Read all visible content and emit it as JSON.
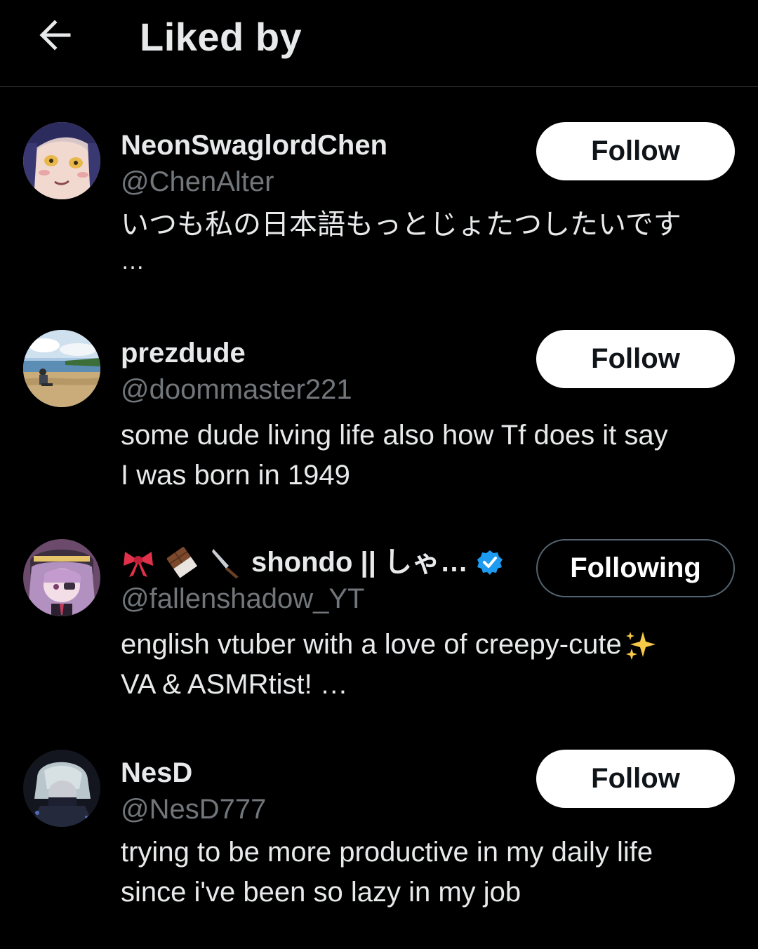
{
  "header": {
    "back_icon": "arrow-left-icon",
    "title": "Liked by"
  },
  "users": [
    {
      "display_name": "NeonSwaglordChen",
      "handle": "@ChenAlter",
      "bio_line1": "いつも私の日本語もっとじょたつしたいです",
      "bio_line2": "…",
      "button": "Follow"
    },
    {
      "display_name": "prezdude",
      "handle": "@doommaster221",
      "bio_line1": "some dude living life also how Tf does it say",
      "bio_line2": "I was born in 1949",
      "button": "Follow"
    },
    {
      "display_name": "shondo || しゃ…",
      "name_emojis": [
        "ribbon-icon",
        "chocolate-icon",
        "knife-icon"
      ],
      "verified": true,
      "handle": "@fallenshadow_YT",
      "bio_line1": "english vtuber with a love of creepy-cute",
      "bio_line1_emoji": "sparkles-icon",
      "bio_line2": "VA & ASMRtist! …",
      "button": "Following"
    },
    {
      "display_name": "NesD",
      "handle": "@NesD777",
      "bio_line1": "trying to be more productive in my daily life",
      "bio_line2": "since i've been so lazy in my job",
      "button": "Follow"
    }
  ],
  "colors": {
    "background": "#000000",
    "text_primary": "#e7e9ea",
    "text_secondary": "#71767b",
    "divider": "#2f3336",
    "verified_blue": "#1d9bf0",
    "following_border": "#536471"
  }
}
